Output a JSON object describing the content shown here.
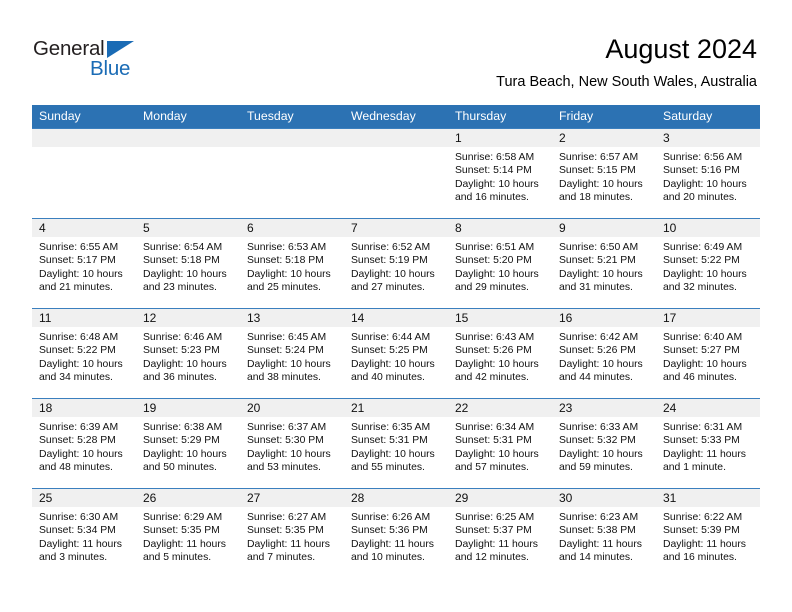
{
  "brand": {
    "name_part1": "General",
    "name_part2": "Blue",
    "triangle_icon": "triangle-icon",
    "accent_color": "#1a6bb5"
  },
  "header": {
    "title": "August 2024",
    "subtitle": "Tura Beach, New South Wales, Australia"
  },
  "theme": {
    "header_blue": "#2c72b3",
    "row_border_blue": "#3b7fbe",
    "daynum_band": "#f0f0f0"
  },
  "calendar": {
    "weekday_headers": [
      "Sunday",
      "Monday",
      "Tuesday",
      "Wednesday",
      "Thursday",
      "Friday",
      "Saturday"
    ],
    "weeks": [
      [
        {
          "day": "",
          "empty": true,
          "sunrise": "",
          "sunset": "",
          "daylight_line1": "",
          "daylight_line2": ""
        },
        {
          "day": "",
          "empty": true,
          "sunrise": "",
          "sunset": "",
          "daylight_line1": "",
          "daylight_line2": ""
        },
        {
          "day": "",
          "empty": true,
          "sunrise": "",
          "sunset": "",
          "daylight_line1": "",
          "daylight_line2": ""
        },
        {
          "day": "",
          "empty": true,
          "sunrise": "",
          "sunset": "",
          "daylight_line1": "",
          "daylight_line2": ""
        },
        {
          "day": "1",
          "empty": false,
          "sunrise": "Sunrise: 6:58 AM",
          "sunset": "Sunset: 5:14 PM",
          "daylight_line1": "Daylight: 10 hours",
          "daylight_line2": "and 16 minutes."
        },
        {
          "day": "2",
          "empty": false,
          "sunrise": "Sunrise: 6:57 AM",
          "sunset": "Sunset: 5:15 PM",
          "daylight_line1": "Daylight: 10 hours",
          "daylight_line2": "and 18 minutes."
        },
        {
          "day": "3",
          "empty": false,
          "sunrise": "Sunrise: 6:56 AM",
          "sunset": "Sunset: 5:16 PM",
          "daylight_line1": "Daylight: 10 hours",
          "daylight_line2": "and 20 minutes."
        }
      ],
      [
        {
          "day": "4",
          "empty": false,
          "sunrise": "Sunrise: 6:55 AM",
          "sunset": "Sunset: 5:17 PM",
          "daylight_line1": "Daylight: 10 hours",
          "daylight_line2": "and 21 minutes."
        },
        {
          "day": "5",
          "empty": false,
          "sunrise": "Sunrise: 6:54 AM",
          "sunset": "Sunset: 5:18 PM",
          "daylight_line1": "Daylight: 10 hours",
          "daylight_line2": "and 23 minutes."
        },
        {
          "day": "6",
          "empty": false,
          "sunrise": "Sunrise: 6:53 AM",
          "sunset": "Sunset: 5:18 PM",
          "daylight_line1": "Daylight: 10 hours",
          "daylight_line2": "and 25 minutes."
        },
        {
          "day": "7",
          "empty": false,
          "sunrise": "Sunrise: 6:52 AM",
          "sunset": "Sunset: 5:19 PM",
          "daylight_line1": "Daylight: 10 hours",
          "daylight_line2": "and 27 minutes."
        },
        {
          "day": "8",
          "empty": false,
          "sunrise": "Sunrise: 6:51 AM",
          "sunset": "Sunset: 5:20 PM",
          "daylight_line1": "Daylight: 10 hours",
          "daylight_line2": "and 29 minutes."
        },
        {
          "day": "9",
          "empty": false,
          "sunrise": "Sunrise: 6:50 AM",
          "sunset": "Sunset: 5:21 PM",
          "daylight_line1": "Daylight: 10 hours",
          "daylight_line2": "and 31 minutes."
        },
        {
          "day": "10",
          "empty": false,
          "sunrise": "Sunrise: 6:49 AM",
          "sunset": "Sunset: 5:22 PM",
          "daylight_line1": "Daylight: 10 hours",
          "daylight_line2": "and 32 minutes."
        }
      ],
      [
        {
          "day": "11",
          "empty": false,
          "sunrise": "Sunrise: 6:48 AM",
          "sunset": "Sunset: 5:22 PM",
          "daylight_line1": "Daylight: 10 hours",
          "daylight_line2": "and 34 minutes."
        },
        {
          "day": "12",
          "empty": false,
          "sunrise": "Sunrise: 6:46 AM",
          "sunset": "Sunset: 5:23 PM",
          "daylight_line1": "Daylight: 10 hours",
          "daylight_line2": "and 36 minutes."
        },
        {
          "day": "13",
          "empty": false,
          "sunrise": "Sunrise: 6:45 AM",
          "sunset": "Sunset: 5:24 PM",
          "daylight_line1": "Daylight: 10 hours",
          "daylight_line2": "and 38 minutes."
        },
        {
          "day": "14",
          "empty": false,
          "sunrise": "Sunrise: 6:44 AM",
          "sunset": "Sunset: 5:25 PM",
          "daylight_line1": "Daylight: 10 hours",
          "daylight_line2": "and 40 minutes."
        },
        {
          "day": "15",
          "empty": false,
          "sunrise": "Sunrise: 6:43 AM",
          "sunset": "Sunset: 5:26 PM",
          "daylight_line1": "Daylight: 10 hours",
          "daylight_line2": "and 42 minutes."
        },
        {
          "day": "16",
          "empty": false,
          "sunrise": "Sunrise: 6:42 AM",
          "sunset": "Sunset: 5:26 PM",
          "daylight_line1": "Daylight: 10 hours",
          "daylight_line2": "and 44 minutes."
        },
        {
          "day": "17",
          "empty": false,
          "sunrise": "Sunrise: 6:40 AM",
          "sunset": "Sunset: 5:27 PM",
          "daylight_line1": "Daylight: 10 hours",
          "daylight_line2": "and 46 minutes."
        }
      ],
      [
        {
          "day": "18",
          "empty": false,
          "sunrise": "Sunrise: 6:39 AM",
          "sunset": "Sunset: 5:28 PM",
          "daylight_line1": "Daylight: 10 hours",
          "daylight_line2": "and 48 minutes."
        },
        {
          "day": "19",
          "empty": false,
          "sunrise": "Sunrise: 6:38 AM",
          "sunset": "Sunset: 5:29 PM",
          "daylight_line1": "Daylight: 10 hours",
          "daylight_line2": "and 50 minutes."
        },
        {
          "day": "20",
          "empty": false,
          "sunrise": "Sunrise: 6:37 AM",
          "sunset": "Sunset: 5:30 PM",
          "daylight_line1": "Daylight: 10 hours",
          "daylight_line2": "and 53 minutes."
        },
        {
          "day": "21",
          "empty": false,
          "sunrise": "Sunrise: 6:35 AM",
          "sunset": "Sunset: 5:31 PM",
          "daylight_line1": "Daylight: 10 hours",
          "daylight_line2": "and 55 minutes."
        },
        {
          "day": "22",
          "empty": false,
          "sunrise": "Sunrise: 6:34 AM",
          "sunset": "Sunset: 5:31 PM",
          "daylight_line1": "Daylight: 10 hours",
          "daylight_line2": "and 57 minutes."
        },
        {
          "day": "23",
          "empty": false,
          "sunrise": "Sunrise: 6:33 AM",
          "sunset": "Sunset: 5:32 PM",
          "daylight_line1": "Daylight: 10 hours",
          "daylight_line2": "and 59 minutes."
        },
        {
          "day": "24",
          "empty": false,
          "sunrise": "Sunrise: 6:31 AM",
          "sunset": "Sunset: 5:33 PM",
          "daylight_line1": "Daylight: 11 hours",
          "daylight_line2": "and 1 minute."
        }
      ],
      [
        {
          "day": "25",
          "empty": false,
          "sunrise": "Sunrise: 6:30 AM",
          "sunset": "Sunset: 5:34 PM",
          "daylight_line1": "Daylight: 11 hours",
          "daylight_line2": "and 3 minutes."
        },
        {
          "day": "26",
          "empty": false,
          "sunrise": "Sunrise: 6:29 AM",
          "sunset": "Sunset: 5:35 PM",
          "daylight_line1": "Daylight: 11 hours",
          "daylight_line2": "and 5 minutes."
        },
        {
          "day": "27",
          "empty": false,
          "sunrise": "Sunrise: 6:27 AM",
          "sunset": "Sunset: 5:35 PM",
          "daylight_line1": "Daylight: 11 hours",
          "daylight_line2": "and 7 minutes."
        },
        {
          "day": "28",
          "empty": false,
          "sunrise": "Sunrise: 6:26 AM",
          "sunset": "Sunset: 5:36 PM",
          "daylight_line1": "Daylight: 11 hours",
          "daylight_line2": "and 10 minutes."
        },
        {
          "day": "29",
          "empty": false,
          "sunrise": "Sunrise: 6:25 AM",
          "sunset": "Sunset: 5:37 PM",
          "daylight_line1": "Daylight: 11 hours",
          "daylight_line2": "and 12 minutes."
        },
        {
          "day": "30",
          "empty": false,
          "sunrise": "Sunrise: 6:23 AM",
          "sunset": "Sunset: 5:38 PM",
          "daylight_line1": "Daylight: 11 hours",
          "daylight_line2": "and 14 minutes."
        },
        {
          "day": "31",
          "empty": false,
          "sunrise": "Sunrise: 6:22 AM",
          "sunset": "Sunset: 5:39 PM",
          "daylight_line1": "Daylight: 11 hours",
          "daylight_line2": "and 16 minutes."
        }
      ]
    ]
  }
}
